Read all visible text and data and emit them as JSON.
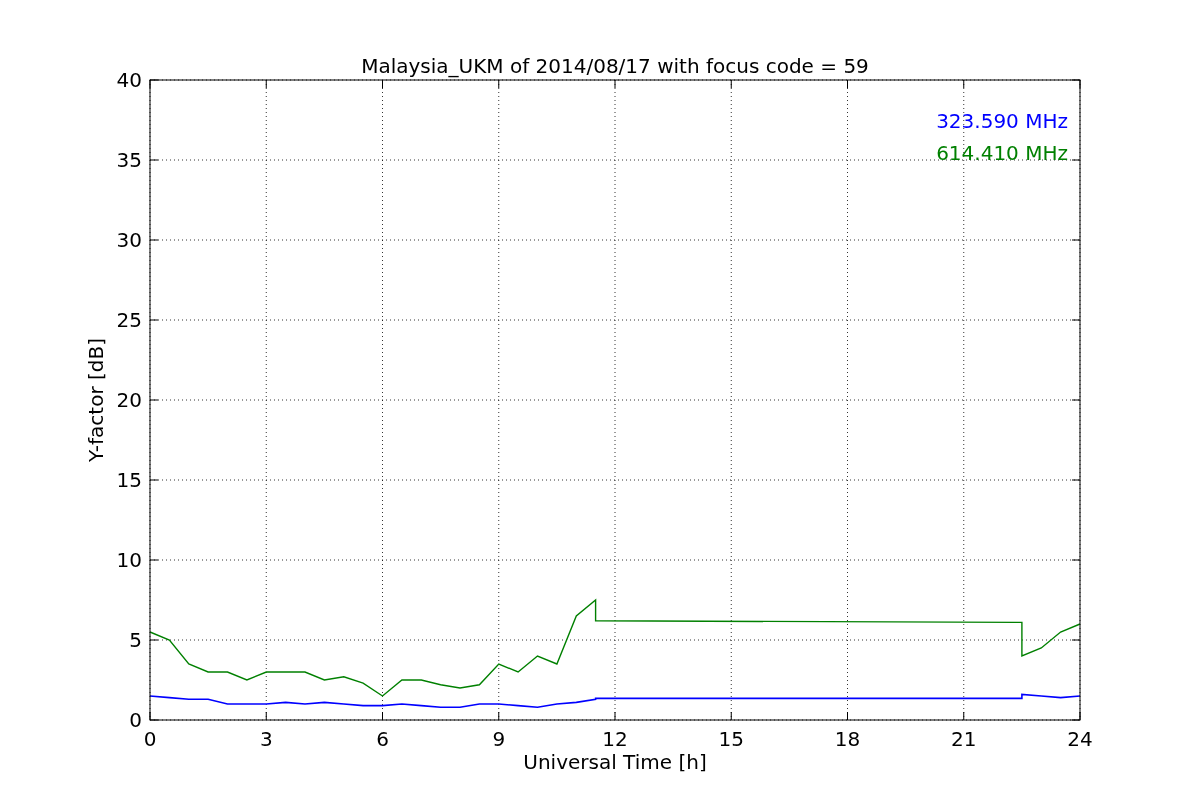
{
  "figure": {
    "chart_data": {
      "type": "line",
      "title": "Malaysia_UKM of 2014/08/17 with focus code = 59",
      "xlabel": "Universal Time [h]",
      "ylabel": "Y-factor [dB]",
      "xlim": [
        0,
        24
      ],
      "ylim": [
        0,
        40
      ],
      "xticks": [
        0,
        3,
        6,
        9,
        12,
        15,
        18,
        21,
        24
      ],
      "yticks": [
        0,
        5,
        10,
        15,
        20,
        25,
        30,
        35,
        40
      ],
      "grid": true,
      "x": [
        0,
        0.5,
        1,
        1.5,
        2,
        2.5,
        3,
        3.5,
        4,
        4.5,
        5,
        5.5,
        6,
        6.5,
        7,
        7.5,
        8,
        8.5,
        9,
        9.5,
        10,
        10.5,
        11,
        11.5,
        11.5,
        22.5,
        22.5,
        23,
        23.5,
        24
      ],
      "series": [
        {
          "name": "323.590 MHz",
          "color": "#0000ff",
          "values": [
            1.5,
            1.4,
            1.3,
            1.3,
            1.0,
            1.0,
            1.0,
            1.1,
            1.0,
            1.1,
            1.0,
            0.9,
            0.9,
            1.0,
            0.9,
            0.8,
            0.8,
            1.0,
            1.0,
            0.9,
            0.8,
            1.0,
            1.1,
            1.3,
            1.35,
            1.35,
            1.6,
            1.5,
            1.4,
            1.5
          ]
        },
        {
          "name": "614.410 MHz",
          "color": "#008000",
          "values": [
            5.5,
            5,
            3.5,
            3,
            3,
            2.5,
            3,
            3,
            3,
            2.5,
            2.7,
            2.3,
            1.5,
            2.5,
            2.5,
            2.2,
            2,
            2.2,
            3.5,
            3,
            4,
            3.5,
            6.5,
            7.5,
            6.2,
            6.1,
            4,
            4.5,
            5.5,
            6
          ]
        }
      ]
    }
  }
}
